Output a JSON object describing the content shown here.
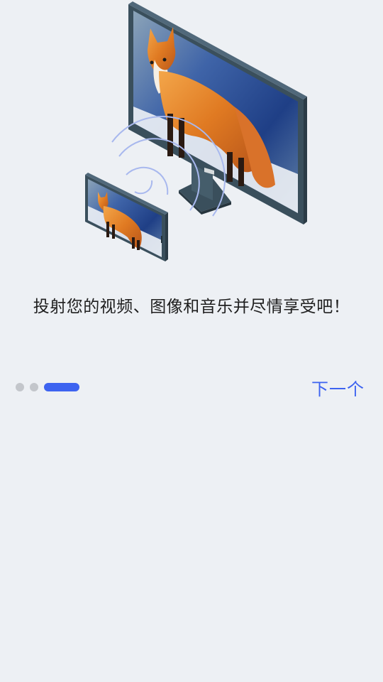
{
  "onboarding": {
    "caption": "投射您的视频、图像和音乐并尽情享受吧！",
    "next_label": "下一个",
    "page_count": 3,
    "current_page": 3
  },
  "colors": {
    "background": "#edf0f4",
    "accent": "#3d63f0",
    "inactive_dot": "#c3c6cb",
    "device_frame": "#3a4f5c"
  },
  "illustration": {
    "icons": [
      "monitor-icon",
      "phone-icon",
      "cast-waves-icon"
    ]
  }
}
